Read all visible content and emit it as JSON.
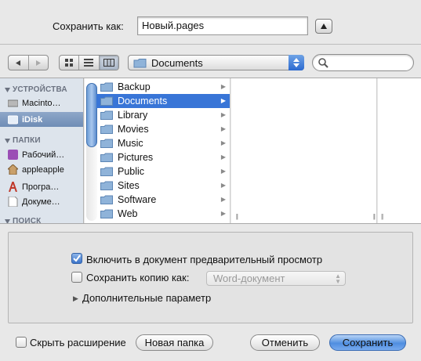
{
  "header": {
    "save_as_label": "Сохранить как:",
    "file_name": "Новый.pages"
  },
  "toolbar": {
    "location": "Documents",
    "view_modes": [
      "icon-view",
      "list-view",
      "column-view"
    ],
    "selected_view": "column-view"
  },
  "sidebar": {
    "sections": [
      {
        "title": "УСТРОЙСТВА",
        "items": [
          {
            "label": "Macintosh HD",
            "display": "Macinto…",
            "icon": "hard-drive-icon"
          },
          {
            "label": "iDisk",
            "display": "iDisk",
            "icon": "idisk-icon",
            "selected": true
          }
        ]
      },
      {
        "title": "ПАПКИ",
        "items": [
          {
            "label": "Рабочий стол",
            "display": "Рабочий…",
            "icon": "desktop-icon"
          },
          {
            "label": "appleapple",
            "display": "appleapple",
            "icon": "home-icon"
          },
          {
            "label": "Программы",
            "display": "Програ…",
            "icon": "applications-icon"
          },
          {
            "label": "Документы",
            "display": "Докуме…",
            "icon": "documents-icon"
          }
        ]
      },
      {
        "title": "ПОИСК"
      }
    ]
  },
  "browser": {
    "column1": [
      "Backup",
      "Documents",
      "Library",
      "Movies",
      "Music",
      "Pictures",
      "Public",
      "Sites",
      "Software",
      "Web"
    ],
    "selected": "Documents"
  },
  "options": {
    "include_preview": "Включить в документ предварительный просмотр",
    "include_preview_checked": true,
    "save_copy_as": "Сохранить копию как:",
    "save_copy_checked": false,
    "copy_format": "Word-документ",
    "advanced": "Дополнительные параметр"
  },
  "footer": {
    "hide_extension": "Скрыть расширение",
    "hide_extension_checked": false,
    "new_folder": "Новая папка",
    "cancel": "Отменить",
    "save": "Сохранить"
  },
  "colors": {
    "accent": "#3875d7",
    "sidebar_bg": "#dde4ec"
  }
}
